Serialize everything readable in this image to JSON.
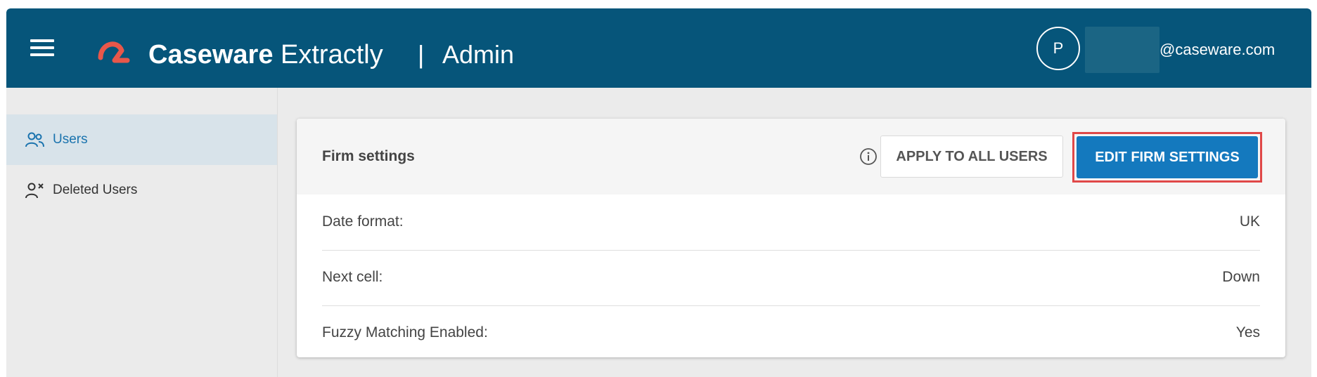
{
  "header": {
    "brand_bold": "Caseware",
    "brand_light": " Extractly",
    "separator": "|",
    "section": "Admin",
    "menu_icon": "hamburger-menu-icon",
    "logo_icon": "caseware-logo-icon",
    "user": {
      "avatar_initial": "P",
      "email_suffix": "@caseware.com"
    }
  },
  "sidebar": {
    "items": [
      {
        "label": "Users",
        "icon": "users-icon",
        "active": true
      },
      {
        "label": "Deleted Users",
        "icon": "user-remove-icon",
        "active": false
      }
    ]
  },
  "firm_settings": {
    "title": "Firm settings",
    "info_icon": "info-icon",
    "apply_label": "APPLY TO ALL USERS",
    "edit_label": "EDIT FIRM SETTINGS",
    "rows": [
      {
        "label": "Date format:",
        "value": "UK"
      },
      {
        "label": "Next cell:",
        "value": "Down"
      },
      {
        "label": "Fuzzy Matching Enabled:",
        "value": "Yes"
      }
    ]
  },
  "colors": {
    "header_bg": "#06557a",
    "accent_blue": "#1479be",
    "logo_red": "#e8574a",
    "highlight_red": "#e04848",
    "sidebar_active": "#d8e3ea"
  }
}
